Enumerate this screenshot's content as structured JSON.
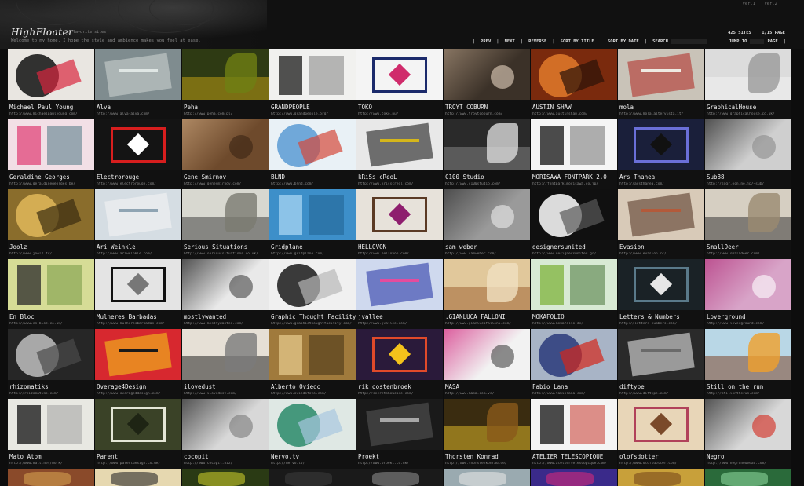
{
  "header": {
    "logo": "HighFloater",
    "tagline_small": "my favorite sites",
    "welcome": "Welcome to my home. I hope the style and ambience makes you feel at ease.",
    "versions": [
      "Ver.1",
      "Ver.2"
    ],
    "sites_count": "425 SITES",
    "page_info": "1/15 PAGE"
  },
  "toolbar": {
    "prev": "PREV",
    "next": "NEXT",
    "reverse": "REVERSE",
    "sort_title": "SORT BY TITLE",
    "sort_date": "SORT BY DATE",
    "search_label": "SEARCH",
    "jump_label": "JUMP TO",
    "page_label": "PAGE"
  },
  "sites": [
    {
      "name": "Michael Paul Young",
      "url": "http://www.michaelpaulyoung.com/",
      "bg": "#e9e6e1",
      "fg": "#111111",
      "accent": "#d8263f"
    },
    {
      "name": "Alva",
      "url": "http://www.alva-alva.com/",
      "bg": "#7f8c8f",
      "fg": "#c9d0cf",
      "accent": "#dfe6e4"
    },
    {
      "name": "Peha",
      "url": "http://www.peha.com.pl/",
      "bg": "#2e3a13",
      "fg": "#c7a414",
      "accent": "#6f7f14"
    },
    {
      "name": "GRANDPEOPLE",
      "url": "http://www.grandpeople.org/",
      "bg": "#f1f1ef",
      "fg": "#1a1a1a",
      "accent": "#777777"
    },
    {
      "name": "TOKO",
      "url": "http://www.toko.nu/",
      "bg": "#f4f4f4",
      "fg": "#1b2a6b",
      "accent": "#d02b6b"
    },
    {
      "name": "TROYT COBURN",
      "url": "http://www.troytcoburn.com/",
      "bg": "#3b3128",
      "fg": "#a8927b",
      "accent": "#e7d6c2"
    },
    {
      "name": "AUSTIN SHAW",
      "url": "http://www.austinshaw.com/",
      "bg": "#7a2a0d",
      "fg": "#e27a2b",
      "accent": "#2b1208"
    },
    {
      "name": "mola",
      "url": "http://www.mola.altervista.it/",
      "bg": "#c9c3b8",
      "fg": "#b2322c",
      "accent": "#eeeae2"
    },
    {
      "name": "GraphicalHouse",
      "url": "http://www.graphicalhouse.co.uk/",
      "bg": "#dcdcdc",
      "fg": "#f4f4f4",
      "accent": "#9a9a9a"
    },
    {
      "name": "Geraldine Georges",
      "url": "http://www.geraldinegeorges.be/",
      "bg": "#f2dfe6",
      "fg": "#e0457a",
      "accent": "#3d6e7a"
    },
    {
      "name": "Electrorouge",
      "url": "http://www.electrorouge.com/",
      "bg": "#141414",
      "fg": "#d71e1e",
      "accent": "#ffffff"
    },
    {
      "name": "Gene Smirnov",
      "url": "http://www.genesmirnov.com/",
      "bg": "#6e4a2c",
      "fg": "#c8a27a",
      "accent": "#3a2414"
    },
    {
      "name": "BLND",
      "url": "http://www.blnd.com/",
      "bg": "#e9f1f6",
      "fg": "#5a9bd4",
      "accent": "#d4483b"
    },
    {
      "name": "kRiSs cReoL",
      "url": "http://www.krisscreol.com/",
      "bg": "#e8e8e8",
      "fg": "#1a1a1a",
      "accent": "#d4b61b"
    },
    {
      "name": "C100 Studio",
      "url": "http://www.c100studio.com/",
      "bg": "#2a2a2a",
      "fg": "#8a8a8a",
      "accent": "#d9d9d9"
    },
    {
      "name": "MORISAWA FONTPARK 2.0",
      "url": "http://fontpark.morisawa.co.jp/",
      "bg": "#f5f5f5",
      "fg": "#111111",
      "accent": "#666666"
    },
    {
      "name": "Ars Thanea",
      "url": "http://arsthanea.com/",
      "bg": "#1a1f3a",
      "fg": "#6a6fd8",
      "accent": "#111111"
    },
    {
      "name": "Sub88",
      "url": "http://sdgr.ocn.ne.jp/~sub/",
      "bg": "#cfcfcf",
      "fg": "#1a1a1a",
      "accent": "#8a8a8a"
    },
    {
      "name": "Joolz",
      "url": "http://www.joolz.fr/",
      "bg": "#8a6d2c",
      "fg": "#e0b85a",
      "accent": "#3a2c10"
    },
    {
      "name": "Ari Weinkle",
      "url": "http://www.ariweinkle.com/",
      "bg": "#d5dde3",
      "fg": "#f4f4f4",
      "accent": "#8fa4b3"
    },
    {
      "name": "Serious Situations",
      "url": "http://www.serioussituations.co.uk/",
      "bg": "#d8d8d0",
      "fg": "#333333",
      "accent": "#7a7a70"
    },
    {
      "name": "Gridplane",
      "url": "http://www.gridplane.com/",
      "bg": "#3d8fc9",
      "fg": "#a7d4f1",
      "accent": "#1e5d8c"
    },
    {
      "name": "HELLOVON",
      "url": "http://www.hellovon.com/",
      "bg": "#e7e2da",
      "fg": "#5b3a24",
      "accent": "#8e1e6e"
    },
    {
      "name": "sam weber",
      "url": "http://www.samweber.com/",
      "bg": "#9a9a9a",
      "fg": "#2c2c2c",
      "accent": "#ececec"
    },
    {
      "name": "designersunited",
      "url": "http://www.designersunited.gr/",
      "bg": "#101010",
      "fg": "#ffffff",
      "accent": "#5a5a5a"
    },
    {
      "name": "Evasion",
      "url": "http://www.evasion.cc/",
      "bg": "#d8cab8",
      "fg": "#5a3a2a",
      "accent": "#b35a3a"
    },
    {
      "name": "SmallDeer",
      "url": "http://www.smalldeer.com/",
      "bg": "#d6cfc2",
      "fg": "#2a2a2a",
      "accent": "#9a8a70"
    },
    {
      "name": "En Bloc",
      "url": "http://www.en-bloc.co.uk/",
      "bg": "#d6dc96",
      "fg": "#2a2a2a",
      "accent": "#6a8f3a"
    },
    {
      "name": "Mulheres Barbadas",
      "url": "http://www.mulheresbarbadas.com/",
      "bg": "#e4e4e4",
      "fg": "#111111",
      "accent": "#777777"
    },
    {
      "name": "mostlywanted",
      "url": "http://www.mostlywanted.com/",
      "bg": "#e9e9e9",
      "fg": "#111111",
      "accent": "#444444"
    },
    {
      "name": "Graphic Thought Facility",
      "url": "http://www.graphicthoughtfacility.com/",
      "bg": "#f0f0f0",
      "fg": "#1a1a1a",
      "accent": "#b8b8b8"
    },
    {
      "name": "jvallee",
      "url": "http://www.jvallee.com/",
      "bg": "#cfd9ee",
      "fg": "#2b3ba8",
      "accent": "#e44c9d"
    },
    {
      "name": ".GIANLUCA FALLONI",
      "url": "http://www.gianlucafalloni.com/",
      "bg": "#e1c89b",
      "fg": "#9a5a2a",
      "accent": "#f0e0c0"
    },
    {
      "name": "MOKAFOLIO",
      "url": "http://www.mokafolio.de/",
      "bg": "#d8ead4",
      "fg": "#7fb33c",
      "accent": "#3a6a2a"
    },
    {
      "name": "Letters & Numbers",
      "url": "http://letters-numbers.com/",
      "bg": "#1a2226",
      "fg": "#5a7a8a",
      "accent": "#e6e6e6"
    },
    {
      "name": "Loverground",
      "url": "http://www.loverground.com/",
      "bg": "#d8a4c8",
      "fg": "#b1307a",
      "accent": "#ffffff"
    },
    {
      "name": "rhizomatiks",
      "url": "http://rhizomatiks.com/",
      "bg": "#262626",
      "fg": "#bfbfbf",
      "accent": "#4a4a4a"
    },
    {
      "name": "Overage4Design",
      "url": "http://www.overage4design.com/",
      "bg": "#d7282f",
      "fg": "#f4c21b",
      "accent": "#1a1a1a"
    },
    {
      "name": "ilovedust",
      "url": "http://www.ilovedust.com/",
      "bg": "#e6e0d6",
      "fg": "#111111",
      "accent": "#7a7a7a"
    },
    {
      "name": "Alberto Oviedo",
      "url": "http://www.oviedofoto.com/",
      "bg": "#a07a3c",
      "fg": "#e4c88a",
      "accent": "#3a2a10"
    },
    {
      "name": "rik oostenbroek",
      "url": "http://secretshowcase.com/",
      "bg": "#2a1a3a",
      "fg": "#e04a2a",
      "accent": "#f4c21b"
    },
    {
      "name": "MASA",
      "url": "http://www.masa.com.ve/",
      "bg": "#f2f2f2",
      "fg": "#d21f7a",
      "accent": "#444444"
    },
    {
      "name": "Fabio Lana",
      "url": "http://www.fabiolana.com/",
      "bg": "#a8b4c6",
      "fg": "#2a3a7a",
      "accent": "#d4271b"
    },
    {
      "name": "diftype",
      "url": "http://www.diftype.com/",
      "bg": "#2a2a2a",
      "fg": "#e6e6e6",
      "accent": "#6a6a6a"
    },
    {
      "name": "Still on the run",
      "url": "http://stillontherun.com/",
      "bg": "#b9d7e6",
      "fg": "#7a3a1a",
      "accent": "#f0a02a"
    },
    {
      "name": "Mato Atom",
      "url": "http://www.matt.net/work/",
      "bg": "#e8e8e2",
      "fg": "#111111",
      "accent": "#999999"
    },
    {
      "name": "Parent",
      "url": "http://www.parentdesign.co.uk/",
      "bg": "#3a4227",
      "fg": "#e4e6d6",
      "accent": "#1e2414"
    },
    {
      "name": "cocopit",
      "url": "http://www.cocopit.biz/",
      "bg": "#d8d8d8",
      "fg": "#1a1a1a",
      "accent": "#7a7a7a"
    },
    {
      "name": "Nervo.tv",
      "url": "http://nervo.tv/",
      "bg": "#dfe8e4",
      "fg": "#2a8a6a",
      "accent": "#a8c8e0"
    },
    {
      "name": "Proekt",
      "url": "http://www.proekt.co.uk/",
      "bg": "#1a1a1a",
      "fg": "#555555",
      "accent": "#a8a8a8"
    },
    {
      "name": "Thorsten Konrad",
      "url": "http://www.thorstenkonrad.de/",
      "bg": "#3a2c10",
      "fg": "#e8c02a",
      "accent": "#8a5a1a"
    },
    {
      "name": "ATELIER TELESCOPIQUE",
      "url": "http://www.ateliertelescopique.com/",
      "bg": "#f4f4f4",
      "fg": "#111111",
      "accent": "#c4271b"
    },
    {
      "name": "olofsdotter",
      "url": "http://www.olofsdotter.com/",
      "bg": "#e8d6b8",
      "fg": "#b1425a",
      "accent": "#7a4a2a"
    },
    {
      "name": "Negro",
      "url": "http://www.negronouveau.com/",
      "bg": "#d8d8d8",
      "fg": "#1a1a1a",
      "accent": "#d4271b"
    }
  ],
  "partial_row": [
    {
      "bg": "#8a4a2a",
      "fg": "#d4a050"
    },
    {
      "bg": "#e6d8b0",
      "fg": "#2a2a2a"
    },
    {
      "bg": "#2a3a14",
      "fg": "#c8c82a"
    },
    {
      "bg": "#1a1a1a",
      "fg": "#3a3a3a"
    },
    {
      "bg": "#1a1a1a",
      "fg": "#8a8a8a"
    },
    {
      "bg": "#9aaab0",
      "fg": "#e4e4e4"
    },
    {
      "bg": "#3a2a8a",
      "fg": "#d42a7a"
    },
    {
      "bg": "#c8a03a",
      "fg": "#7a4a1a"
    },
    {
      "bg": "#2a6a3a",
      "fg": "#8ad49a"
    }
  ]
}
